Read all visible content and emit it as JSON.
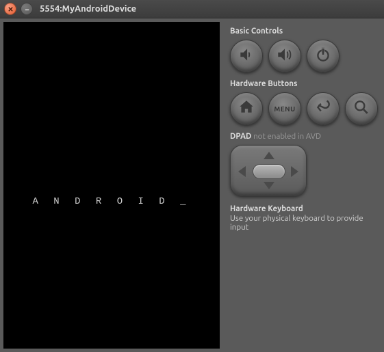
{
  "window": {
    "title": "5554:MyAndroidDevice"
  },
  "screen": {
    "boot_text": "A N D R O I D _"
  },
  "panel": {
    "basic_controls": {
      "title": "Basic Controls"
    },
    "hardware_buttons": {
      "title": "Hardware Buttons",
      "menu_label": "MENU"
    },
    "dpad": {
      "label": "DPAD",
      "status": "not enabled in AVD"
    },
    "hw_keyboard": {
      "title": "Hardware Keyboard",
      "subtitle": "Use your physical keyboard to provide input"
    }
  }
}
